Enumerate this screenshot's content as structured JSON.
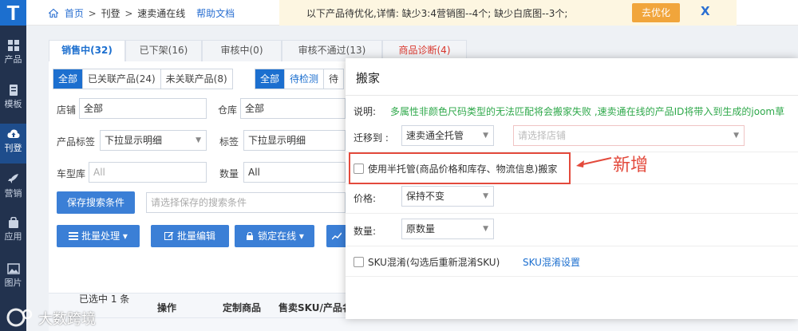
{
  "sidebar": {
    "logo": "T",
    "items": [
      {
        "label": "产品",
        "icon": "grid-icon"
      },
      {
        "label": "模板",
        "icon": "template-icon"
      },
      {
        "label": "刊登",
        "icon": "cloud-upload-icon",
        "active": true
      },
      {
        "label": "营销",
        "icon": "rocket-icon"
      },
      {
        "label": "应用",
        "icon": "bag-icon"
      },
      {
        "label": "图片",
        "icon": "image-icon"
      }
    ]
  },
  "topbar": {
    "breadcrumb": [
      "首页",
      "刊登",
      "速卖通在线"
    ],
    "help_link": "帮助文档",
    "notice": "以下产品待优化,详情: 缺少3:4营销图--4个; 缺少白底图--3个;",
    "optimize_button": "去优化",
    "close": "X"
  },
  "tabs": [
    {
      "label": "销售中(32)",
      "active": true
    },
    {
      "label": "已下架(16)"
    },
    {
      "label": "审核中(0)"
    },
    {
      "label": "审核不通过(13)"
    },
    {
      "label": "商品诊断(4)",
      "diag": true
    }
  ],
  "filters": {
    "assoc_segments": [
      "全部",
      "已关联产品(24)",
      "未关联产品(8)"
    ],
    "status_segments": [
      "全部",
      "待检测",
      "待"
    ],
    "shop_label": "店铺",
    "shop_value": "全部",
    "warehouse_label": "仓库",
    "warehouse_value": "全部",
    "product_tag_label": "产品标签",
    "product_tag_value": "下拉显示明细",
    "tag_label": "标签",
    "tag_value": "下拉显示明细",
    "model_lib_label": "车型库",
    "model_lib_value": "All",
    "quantity_label": "数量",
    "quantity_value": "All",
    "save_search_button": "保存搜索条件",
    "saved_search_placeholder": "请选择保存的搜索条件"
  },
  "toolbar": {
    "batch_process": "批量处理",
    "batch_edit": "批量编辑",
    "lock_online": "锁定在线"
  },
  "table": {
    "headers": [
      "操作",
      "定制商品",
      "售卖SKU/产品名称"
    ],
    "selected_text": "已选中 1 条"
  },
  "modal": {
    "title": "搬家",
    "note_label": "说明:",
    "note_text": "多属性非颜色尺码类型的无法匹配将会搬家失败 ,速卖通在线的产品ID将带入到生成的joom草",
    "migrate_label": "迁移到 :",
    "migrate_value": "速卖通全托管",
    "shop_placeholder": "请选择店铺",
    "semi_managed_label": "使用半托管(商品价格和库存、物流信息)搬家",
    "price_label": "价格:",
    "price_value": "保持不变",
    "qty_label": "数量:",
    "qty_value": "原数量",
    "sku_mix_label": "SKU混淆(勾选后重新混淆SKU)",
    "sku_mix_link": "SKU混淆设置"
  },
  "annotation": {
    "text": "新增",
    "color": "#e34a3c"
  },
  "watermark": {
    "text": "大数跨境"
  },
  "colors": {
    "primary": "#1c6fcf",
    "sidebar": "#22324e",
    "notice_bg": "#fdf6e1",
    "accent_orange": "#f1a53b",
    "note_green": "#2ea84a",
    "danger": "#d9362c"
  }
}
